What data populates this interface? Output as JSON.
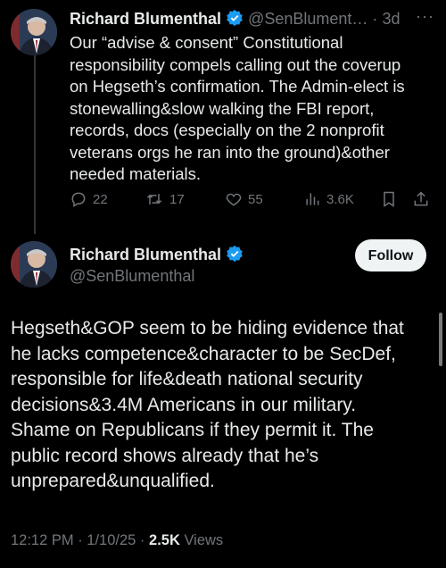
{
  "reply_tweet": {
    "author_name": "Richard Blumenthal",
    "handle": "@SenBlument…",
    "separator": "·",
    "time_ago": "3d",
    "more_label": "···",
    "lines": [
      "Our “advise & consent” Constitutional",
      "responsibility compels calling out the coverup",
      "on Hegseth’s confirmation. The Admin-elect is",
      "stonewalling&slow walking the FBI report,",
      "records, docs (especially on the 2 nonprofit",
      "veterans orgs he ran into the ground)&other",
      "needed materials."
    ],
    "replies": "22",
    "reposts": "17",
    "likes": "55",
    "views": "3.6K"
  },
  "main_tweet": {
    "author_name": "Richard Blumenthal",
    "handle": "@SenBlumenthal",
    "follow_label": "Follow",
    "lines": [
      "Hegseth&GOP seem to be hiding evidence that",
      "he lacks competence&character to be SecDef,",
      "responsible for life&death national security",
      "decisions&3.4M Americans in our military.",
      "Shame on Republicans if they permit it. The",
      "public record shows already that he’s",
      "unprepared&unqualified."
    ],
    "time": "12:12 PM · 1/10/25 · ",
    "views_count": "2.5K",
    "views_label": " Views"
  },
  "icons": [
    "avatar",
    "verified-badge-icon",
    "reply-icon",
    "repost-icon",
    "like-icon",
    "views-icon",
    "bookmark-icon",
    "share-icon",
    "more-icon"
  ],
  "colors": {
    "background": "#000000",
    "text": "#e7e9ea",
    "muted": "#71767b",
    "verified": "#1d9bf0",
    "follow_bg": "#eff3f4"
  }
}
